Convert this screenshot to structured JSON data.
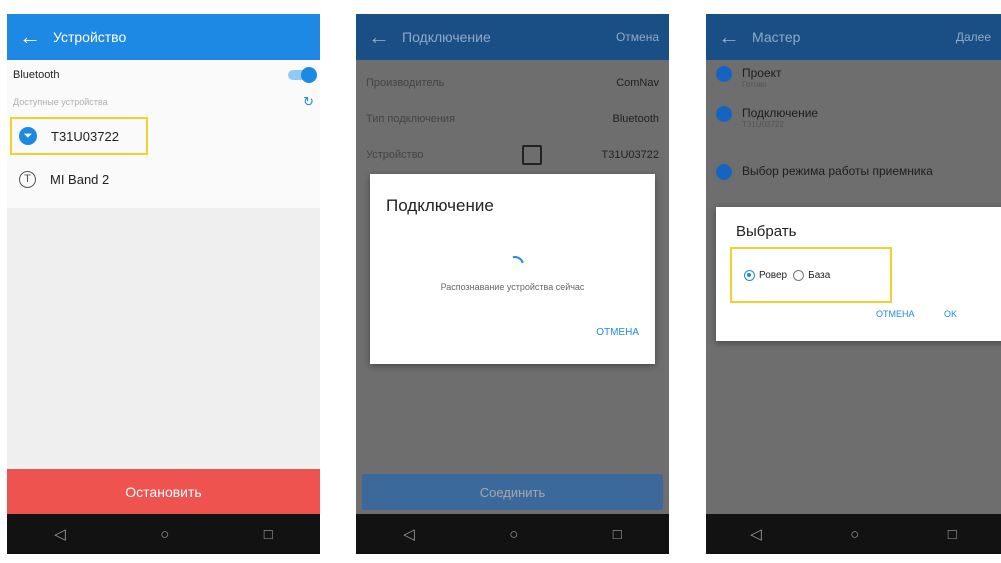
{
  "screen1": {
    "title": "Устройство",
    "bluetooth_label": "Bluetooth",
    "available_label": "Доступные устройства",
    "devices": [
      {
        "name": "T31U03722",
        "connected": true
      },
      {
        "name": "MI Band 2",
        "connected": false
      }
    ],
    "stop_button": "Остановить"
  },
  "screen2": {
    "title": "Подключение",
    "action": "Отмена",
    "rows": [
      {
        "label": "Производитель",
        "value": "ComNav"
      },
      {
        "label": "Тип подключения",
        "value": "Bluetooth"
      },
      {
        "label": "Устройство",
        "value": "T31U03722"
      }
    ],
    "connect_button": "Соединить",
    "dialog": {
      "title": "Подключение",
      "message": "Распознавание устройства сейчас",
      "cancel": "ОТМЕНА"
    }
  },
  "screen3": {
    "title": "Мастер",
    "action": "Далее",
    "steps": [
      {
        "title": "Проект",
        "subtitle": "Готово"
      },
      {
        "title": "Подключение",
        "subtitle": "T31U03722"
      },
      {
        "title": "Выбор режима работы приемника",
        "subtitle": ""
      }
    ],
    "dialog": {
      "title": "Выбрать",
      "options": [
        {
          "label": "Ровер",
          "selected": true
        },
        {
          "label": "База",
          "selected": false
        }
      ],
      "cancel": "ОТМЕНА",
      "ok": "OK"
    }
  },
  "nav": {
    "back": "◁",
    "home": "○",
    "recent": "□"
  },
  "colors": {
    "primary": "#1e88e5",
    "danger": "#ef5350",
    "highlight": "#f2d02e"
  }
}
